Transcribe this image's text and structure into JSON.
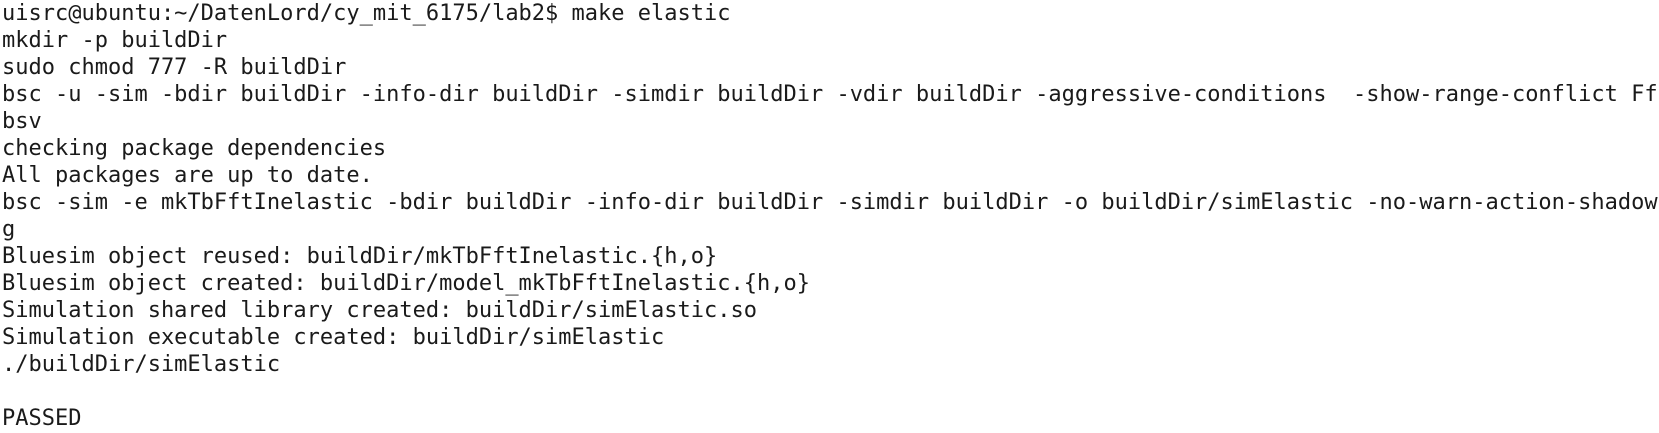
{
  "terminal": {
    "lines": [
      "uisrc@ubuntu:~/DatenLord/cy_mit_6175/lab2$ make elastic",
      "mkdir -p buildDir",
      "sudo chmod 777 -R buildDir",
      "bsc -u -sim -bdir buildDir -info-dir buildDir -simdir buildDir -vdir buildDir -aggressive-conditions  -show-range-conflict Fft.",
      "bsv",
      "checking package dependencies",
      "All packages are up to date.",
      "bsc -sim -e mkTbFftInelastic -bdir buildDir -info-dir buildDir -simdir buildDir -o buildDir/simElastic -no-warn-action-shadowin",
      "g",
      "Bluesim object reused: buildDir/mkTbFftInelastic.{h,o}",
      "Bluesim object created: buildDir/model_mkTbFftInelastic.{h,o}",
      "Simulation shared library created: buildDir/simElastic.so",
      "Simulation executable created: buildDir/simElastic",
      "./buildDir/simElastic",
      "",
      "PASSED"
    ]
  }
}
